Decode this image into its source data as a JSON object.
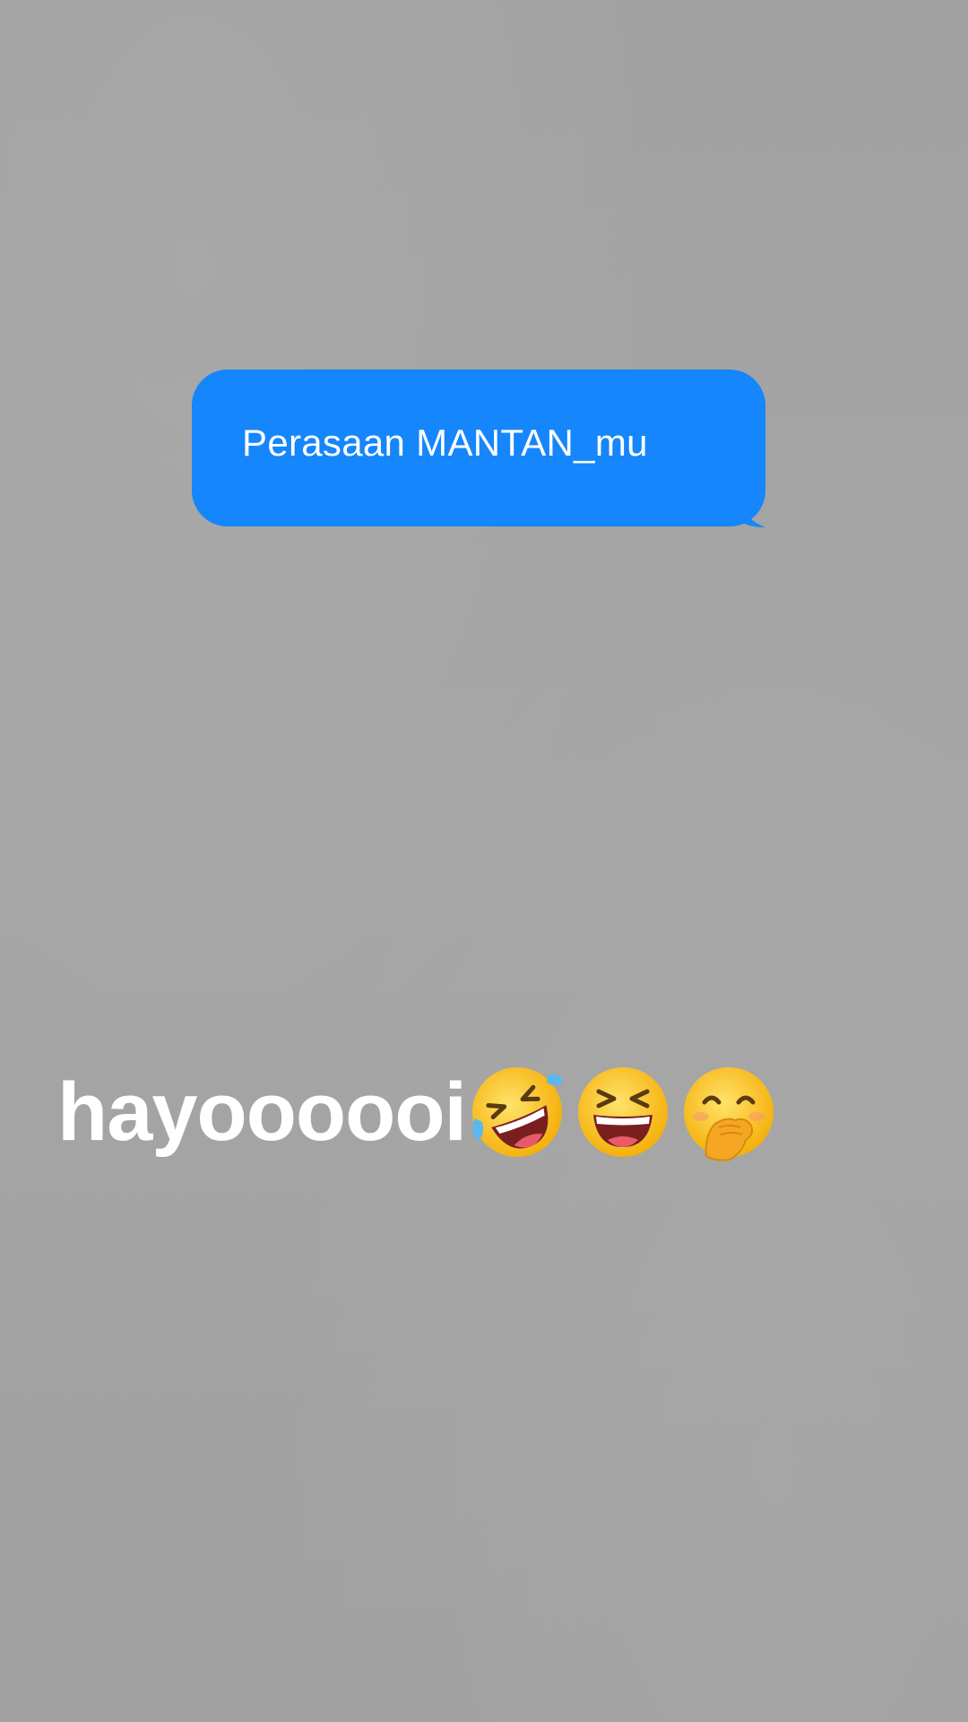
{
  "background_color": "#a3a3a3",
  "message": {
    "text": "Perasaan MANTAN_mu",
    "bubble_color": "#1586fb",
    "text_color": "#ffffff"
  },
  "caption": {
    "text": "hayoooooi",
    "color": "#ffffff",
    "emojis": [
      "rolling-on-floor-laughing-emoji",
      "grinning-squinting-face-emoji",
      "face-with-hand-over-mouth-emoji"
    ]
  }
}
